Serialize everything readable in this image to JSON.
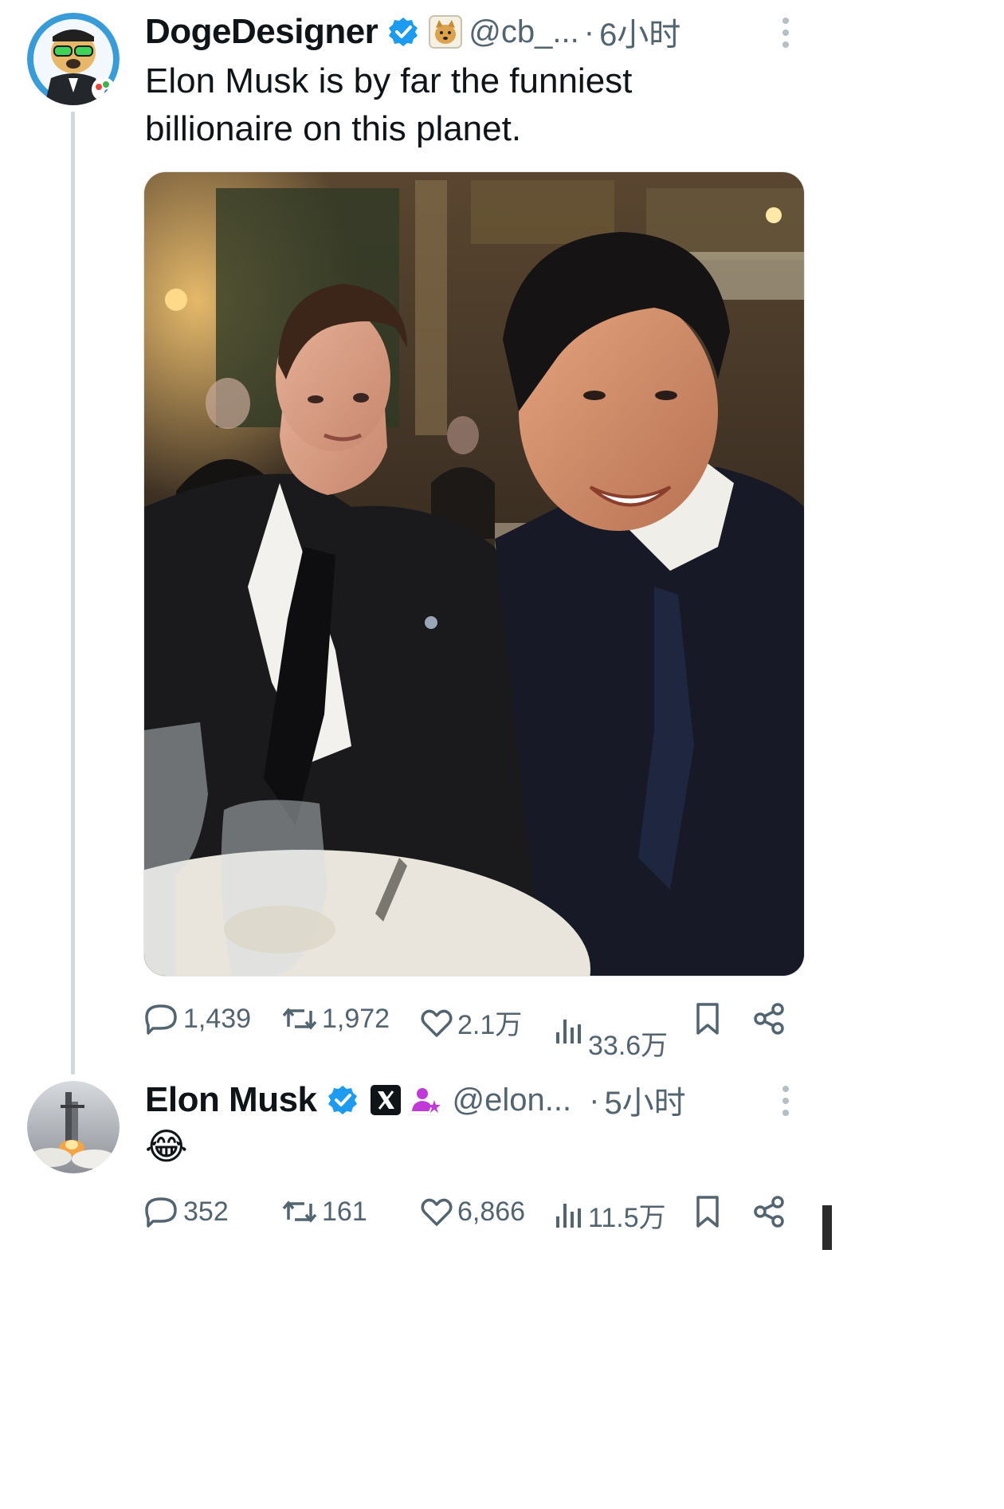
{
  "tweet1": {
    "name": "DogeDesigner",
    "handle": "@cb_...",
    "dot": "·",
    "time": "6小时",
    "text": "Elon Musk is by far the funniest billionaire on this planet.",
    "badges": [
      "verified-check-icon",
      "doge-affiliate-icon"
    ],
    "image": "selfie photo at a dinner banquet",
    "stats": {
      "replies": "1,439",
      "reposts": "1,972",
      "likes": "2.1万",
      "views": "33.6万"
    }
  },
  "tweet2": {
    "name": "Elon Musk",
    "handle": "@elon...",
    "dot": "·",
    "time": "5小时",
    "emoji": "😂",
    "badges": [
      "verified-check-icon",
      "x-affiliate-icon",
      "subscriber-icon"
    ],
    "stats": {
      "replies": "352",
      "reposts": "161",
      "likes": "6,866",
      "views": "11.5万"
    }
  },
  "colors": {
    "verified": "#1d9bf0",
    "text": "#0f1419",
    "muted": "#536471",
    "thread_line": "#cfd9de",
    "subscriber": "#c03ad8"
  }
}
